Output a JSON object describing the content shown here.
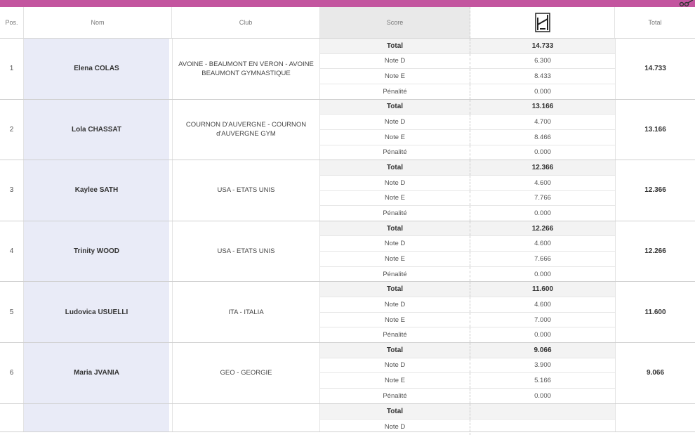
{
  "header": {
    "pos": "Pos.",
    "nom": "Nom",
    "club": "Club",
    "score": "Score",
    "apparatus_icon": "parallel-bars-apparatus-icon",
    "total": "Total"
  },
  "colors": {
    "accent": "#c3559f",
    "name_bg": "#e9ebf7",
    "score_header_bg": "#e9e9e9"
  },
  "rows": [
    {
      "pos": "1",
      "nom": "Elena COLAS",
      "club": "AVOINE - BEAUMONT EN VERON - AVOINE BEAUMONT GYMNASTIQUE",
      "scores": [
        {
          "label": "Total",
          "value": "14.733"
        },
        {
          "label": "Note D",
          "value": "6.300"
        },
        {
          "label": "Note E",
          "value": "8.433"
        },
        {
          "label": "Pénalité",
          "value": "0.000"
        }
      ],
      "total": "14.733"
    },
    {
      "pos": "2",
      "nom": "Lola CHASSAT",
      "club": "COURNON D'AUVERGNE - COURNON d'AUVERGNE GYM",
      "scores": [
        {
          "label": "Total",
          "value": "13.166"
        },
        {
          "label": "Note D",
          "value": "4.700"
        },
        {
          "label": "Note E",
          "value": "8.466"
        },
        {
          "label": "Pénalité",
          "value": "0.000"
        }
      ],
      "total": "13.166"
    },
    {
      "pos": "3",
      "nom": "Kaylee SATH",
      "club": "USA - ETATS UNIS",
      "scores": [
        {
          "label": "Total",
          "value": "12.366"
        },
        {
          "label": "Note D",
          "value": "4.600"
        },
        {
          "label": "Note E",
          "value": "7.766"
        },
        {
          "label": "Pénalité",
          "value": "0.000"
        }
      ],
      "total": "12.366"
    },
    {
      "pos": "4",
      "nom": "Trinity WOOD",
      "club": "USA - ETATS UNIS",
      "scores": [
        {
          "label": "Total",
          "value": "12.266"
        },
        {
          "label": "Note D",
          "value": "4.600"
        },
        {
          "label": "Note E",
          "value": "7.666"
        },
        {
          "label": "Pénalité",
          "value": "0.000"
        }
      ],
      "total": "12.266"
    },
    {
      "pos": "5",
      "nom": "Ludovica USUELLI",
      "club": "ITA - ITALIA",
      "scores": [
        {
          "label": "Total",
          "value": "11.600"
        },
        {
          "label": "Note D",
          "value": "4.600"
        },
        {
          "label": "Note E",
          "value": "7.000"
        },
        {
          "label": "Pénalité",
          "value": "0.000"
        }
      ],
      "total": "11.600"
    },
    {
      "pos": "6",
      "nom": "Maria JVANIA",
      "club": "GEO - GEORGIE",
      "scores": [
        {
          "label": "Total",
          "value": "9.066"
        },
        {
          "label": "Note D",
          "value": "3.900"
        },
        {
          "label": "Note E",
          "value": "5.166"
        },
        {
          "label": "Pénalité",
          "value": "0.000"
        }
      ],
      "total": "9.066"
    }
  ],
  "partial_row": {
    "labels": [
      "Total",
      "Note D"
    ]
  }
}
